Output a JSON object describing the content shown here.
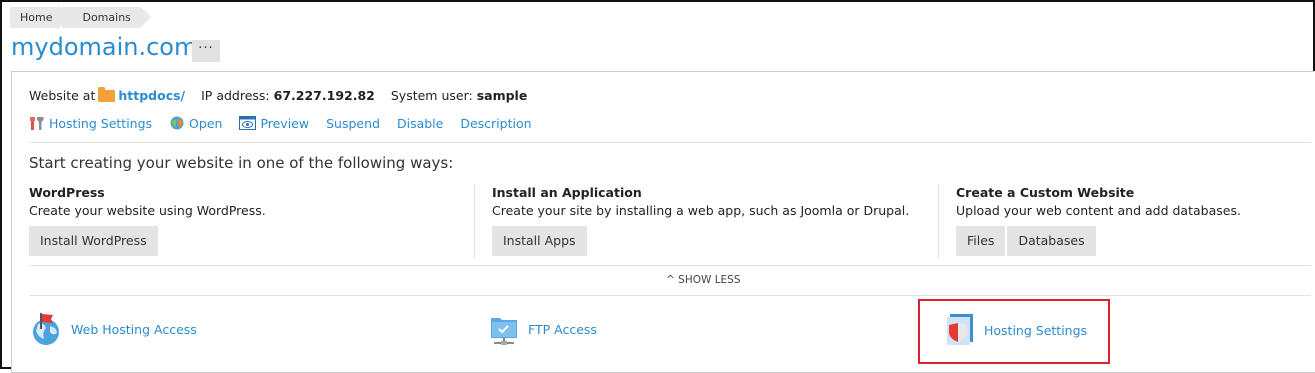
{
  "breadcrumb": [
    "Home",
    "Domains"
  ],
  "domain": {
    "title": "mydomain.com",
    "more_label": "···"
  },
  "info": {
    "website_at_label": "Website at",
    "website_folder": "httpdocs/",
    "ip_label": "IP address:",
    "ip_value": "67.227.192.82",
    "user_label": "System user:",
    "user_value": "sample"
  },
  "actions": {
    "hosting_settings": "Hosting Settings",
    "open": "Open",
    "preview": "Preview",
    "suspend": "Suspend",
    "disable": "Disable",
    "description": "Description"
  },
  "start": {
    "heading": "Start creating your website in one of the following ways:",
    "wordpress": {
      "title": "WordPress",
      "desc": "Create your website using WordPress.",
      "button": "Install WordPress"
    },
    "app": {
      "title": "Install an Application",
      "desc": "Create your site by installing a web app, such as Joomla or Drupal.",
      "button": "Install Apps"
    },
    "custom": {
      "title": "Create a Custom Website",
      "desc": "Upload your web content and add databases.",
      "files_button": "Files",
      "db_button": "Databases"
    }
  },
  "show_less": "SHOW LESS",
  "tools": {
    "web_hosting_access": "Web Hosting Access",
    "ftp_access": "FTP Access",
    "hosting_settings": "Hosting Settings"
  },
  "colors": {
    "link": "#2a8ccf",
    "highlight": "#d9232e",
    "folder": "#f5a13a"
  }
}
